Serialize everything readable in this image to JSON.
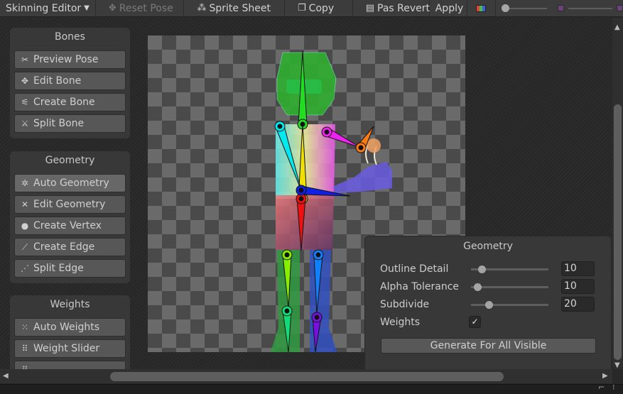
{
  "toolbar": {
    "mode_label": "Skinning Editor",
    "items": [
      {
        "label": "Reset Pose",
        "icon": "reset-pose-icon",
        "disabled": true
      },
      {
        "label": "Sprite Sheet",
        "icon": "sprite-sheet-icon",
        "disabled": false
      },
      {
        "label": "Copy",
        "icon": "copy-icon",
        "disabled": false
      },
      {
        "label": "Pas Revert",
        "icon": "paste-icon",
        "disabled": false
      },
      {
        "label": "Apply",
        "icon": "",
        "disabled": false
      }
    ],
    "color_toggle_icon": "rgb-channels-icon",
    "colors": {
      "accent_red": "#e04040",
      "accent_green": "#40c040",
      "accent_blue": "#4060e0"
    }
  },
  "panels": {
    "bones": {
      "title": "Bones",
      "buttons": [
        {
          "label": "Preview Pose",
          "icon": "preview-pose-icon"
        },
        {
          "label": "Edit Bone",
          "icon": "edit-bone-icon"
        },
        {
          "label": "Create Bone",
          "icon": "create-bone-icon"
        },
        {
          "label": "Split Bone",
          "icon": "split-bone-icon"
        }
      ]
    },
    "geometry": {
      "title": "Geometry",
      "buttons": [
        {
          "label": "Auto Geometry",
          "icon": "auto-geometry-icon",
          "active": true
        },
        {
          "label": "Edit Geometry",
          "icon": "edit-geometry-icon"
        },
        {
          "label": "Create Vertex",
          "icon": "create-vertex-icon"
        },
        {
          "label": "Create Edge",
          "icon": "create-edge-icon"
        },
        {
          "label": "Split Edge",
          "icon": "split-edge-icon"
        }
      ]
    },
    "weights": {
      "title": "Weights",
      "buttons": [
        {
          "label": "Auto Weights",
          "icon": "auto-weights-icon"
        },
        {
          "label": "Weight Slider",
          "icon": "weight-slider-icon"
        },
        {
          "label": "",
          "icon": "weight-brush-icon"
        }
      ]
    }
  },
  "geometry_settings": {
    "title": "Geometry",
    "outline_detail": {
      "label": "Outline Detail",
      "value": "10",
      "slider_fraction": 0.1
    },
    "alpha_tolerance": {
      "label": "Alpha Tolerance",
      "value": "10",
      "slider_fraction": 0.04
    },
    "subdivide": {
      "label": "Subdivide",
      "value": "20",
      "slider_fraction": 0.2
    },
    "weights": {
      "label": "Weights",
      "checked": true,
      "check_glyph": "✓"
    },
    "generate_button": "Generate For All Visible"
  },
  "bones": [
    {
      "name": "head",
      "color": "#22dd22"
    },
    {
      "name": "spine-upper",
      "color": "#f0e000"
    },
    {
      "name": "hip",
      "color": "#ee1111"
    },
    {
      "name": "arm-left",
      "color": "#00e8f0"
    },
    {
      "name": "arm-right-upper",
      "color": "#ee22ee"
    },
    {
      "name": "arm-right-lower",
      "color": "#ff7a10"
    },
    {
      "name": "arm-forward",
      "color": "#1020e0"
    },
    {
      "name": "leg-left-upper",
      "color": "#88ee00"
    },
    {
      "name": "leg-left-lower",
      "color": "#10dd77"
    },
    {
      "name": "leg-right-upper",
      "color": "#1080ff"
    },
    {
      "name": "leg-right-lower",
      "color": "#7a10e0"
    }
  ]
}
